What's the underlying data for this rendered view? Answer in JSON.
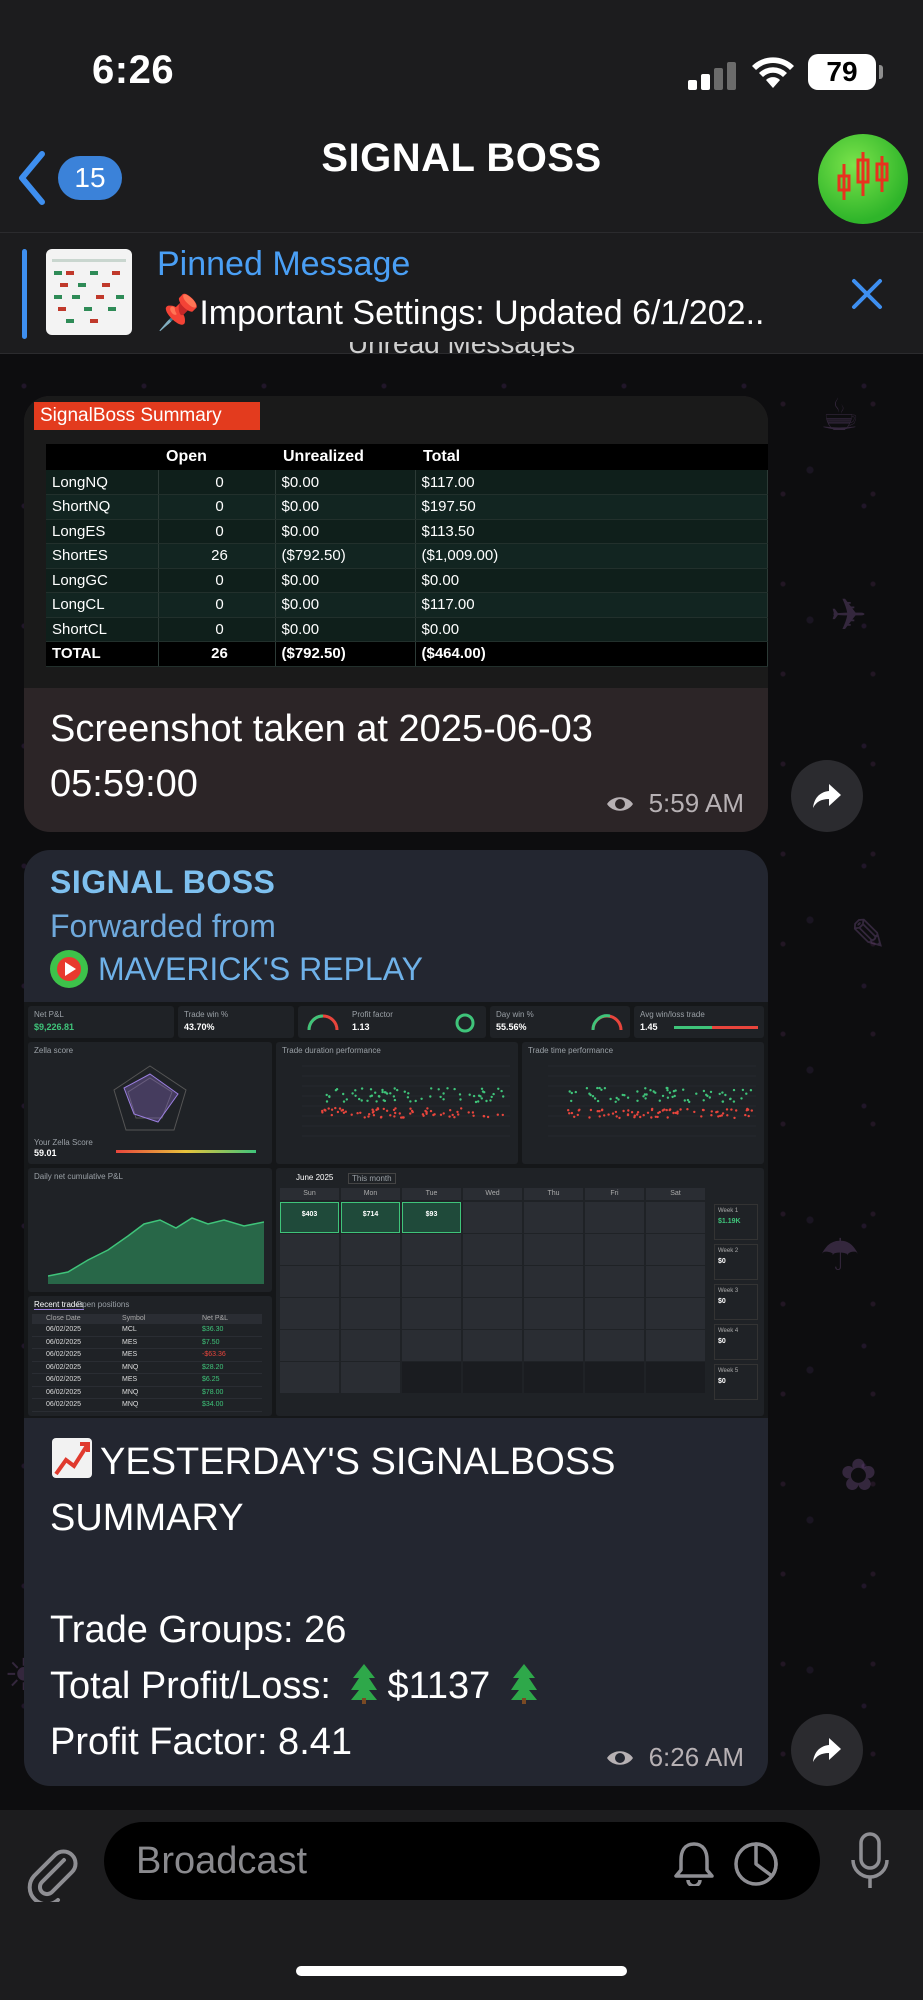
{
  "status_bar": {
    "time": "6:26",
    "battery": "79"
  },
  "header": {
    "back_count": "15",
    "title": "SIGNAL BOSS"
  },
  "pinned": {
    "label": "Pinned Message",
    "text": "📌Important Settings: Updated 6/1/202..",
    "pin_emoji": "📌"
  },
  "separator": "Unread Messages",
  "message1": {
    "image_tab": "SignalBoss Summary",
    "table": {
      "headers": [
        "",
        "Open",
        "Unrealized",
        "Total"
      ],
      "rows": [
        {
          "name": "LongNQ",
          "open": "0",
          "unrealized": "$0.00",
          "total": "$117.00",
          "u_class": "",
          "t_class": "pos"
        },
        {
          "name": "ShortNQ",
          "open": "0",
          "unrealized": "$0.00",
          "total": "$197.50",
          "u_class": "",
          "t_class": "pos"
        },
        {
          "name": "LongES",
          "open": "0",
          "unrealized": "$0.00",
          "total": "$113.50",
          "u_class": "",
          "t_class": "pos"
        },
        {
          "name": "ShortES",
          "open": "26",
          "unrealized": "($792.50)",
          "total": "($1,009.00)",
          "u_class": "neg",
          "t_class": "neg"
        },
        {
          "name": "LongGC",
          "open": "0",
          "unrealized": "$0.00",
          "total": "$0.00",
          "u_class": "",
          "t_class": ""
        },
        {
          "name": "LongCL",
          "open": "0",
          "unrealized": "$0.00",
          "total": "$117.00",
          "u_class": "",
          "t_class": "pos"
        },
        {
          "name": "ShortCL",
          "open": "0",
          "unrealized": "$0.00",
          "total": "$0.00",
          "u_class": "",
          "t_class": ""
        }
      ],
      "total": {
        "name": "TOTAL",
        "open": "26",
        "unrealized": "($792.50)",
        "total": "($464.00)"
      }
    },
    "caption_line1": "Screenshot taken at 2025-06-03",
    "caption_line2": "05:59:00",
    "time": "5:59 AM"
  },
  "message2": {
    "sender": "SIGNAL BOSS",
    "forwarded_label": "Forwarded from",
    "forwarded_source": "MAVERICK'S REPLAY",
    "dashboard": {
      "kpis": [
        {
          "label": "Net P&L",
          "value": "$9,226.81"
        },
        {
          "label": "Trade win %",
          "value": "43.70%"
        },
        {
          "label": "Profit factor",
          "value": "1.13"
        },
        {
          "label": "Day win %",
          "value": "55.56%"
        },
        {
          "label": "Avg win/loss trade",
          "value": "1.45"
        }
      ],
      "panels": [
        "Zella score",
        "Trade duration performance",
        "Trade time performance",
        "Daily net cumulative P&L"
      ],
      "zella_score_label": "Your Zella Score",
      "zella_score": "59.01",
      "month": "June 2025",
      "this_month": "This month",
      "weekdays": [
        "Sun",
        "Mon",
        "Tue",
        "Wed",
        "Thu",
        "Fri",
        "Sat"
      ],
      "day_values": [
        "$403",
        "$714",
        "$93"
      ],
      "weeks": [
        {
          "label": "Week 1",
          "value": "$1.19K"
        },
        {
          "label": "Week 2",
          "value": "$0"
        },
        {
          "label": "Week 3",
          "value": "$0"
        },
        {
          "label": "Week 4",
          "value": "$0"
        },
        {
          "label": "Week 5",
          "value": "$0"
        }
      ],
      "recent_tabs": [
        "Recent trades",
        "Open positions"
      ],
      "recent_headers": [
        "Close Date",
        "Symbol",
        "Net P&L"
      ],
      "recent_rows": [
        {
          "date": "06/02/2025",
          "symbol": "MCL",
          "pnl": "$36.30"
        },
        {
          "date": "06/02/2025",
          "symbol": "MES",
          "pnl": "$7.50"
        },
        {
          "date": "06/02/2025",
          "symbol": "MES",
          "pnl": "-$63.36"
        },
        {
          "date": "06/02/2025",
          "symbol": "MNQ",
          "pnl": "$28.20"
        },
        {
          "date": "06/02/2025",
          "symbol": "MES",
          "pnl": "$6.25"
        },
        {
          "date": "06/02/2025",
          "symbol": "MNQ",
          "pnl": "$78.00"
        },
        {
          "date": "06/02/2025",
          "symbol": "MNQ",
          "pnl": "$34.00"
        }
      ]
    },
    "report_title_line1": "YESTERDAY'S SIGNALBOSS",
    "report_title_line2": "SUMMARY",
    "trade_groups": "Trade Groups: 26",
    "profit_loss_label": "Total Profit/Loss:",
    "profit_loss_value": "$1137",
    "profit_factor": "Profit Factor:  8.41",
    "time": "6:26 AM"
  },
  "input_bar": {
    "placeholder": "Broadcast"
  },
  "colors": {
    "accent": "#3e8ff0",
    "positive": "#35c23a",
    "negative": "#e62b2b",
    "tab": "#e33b1e"
  }
}
